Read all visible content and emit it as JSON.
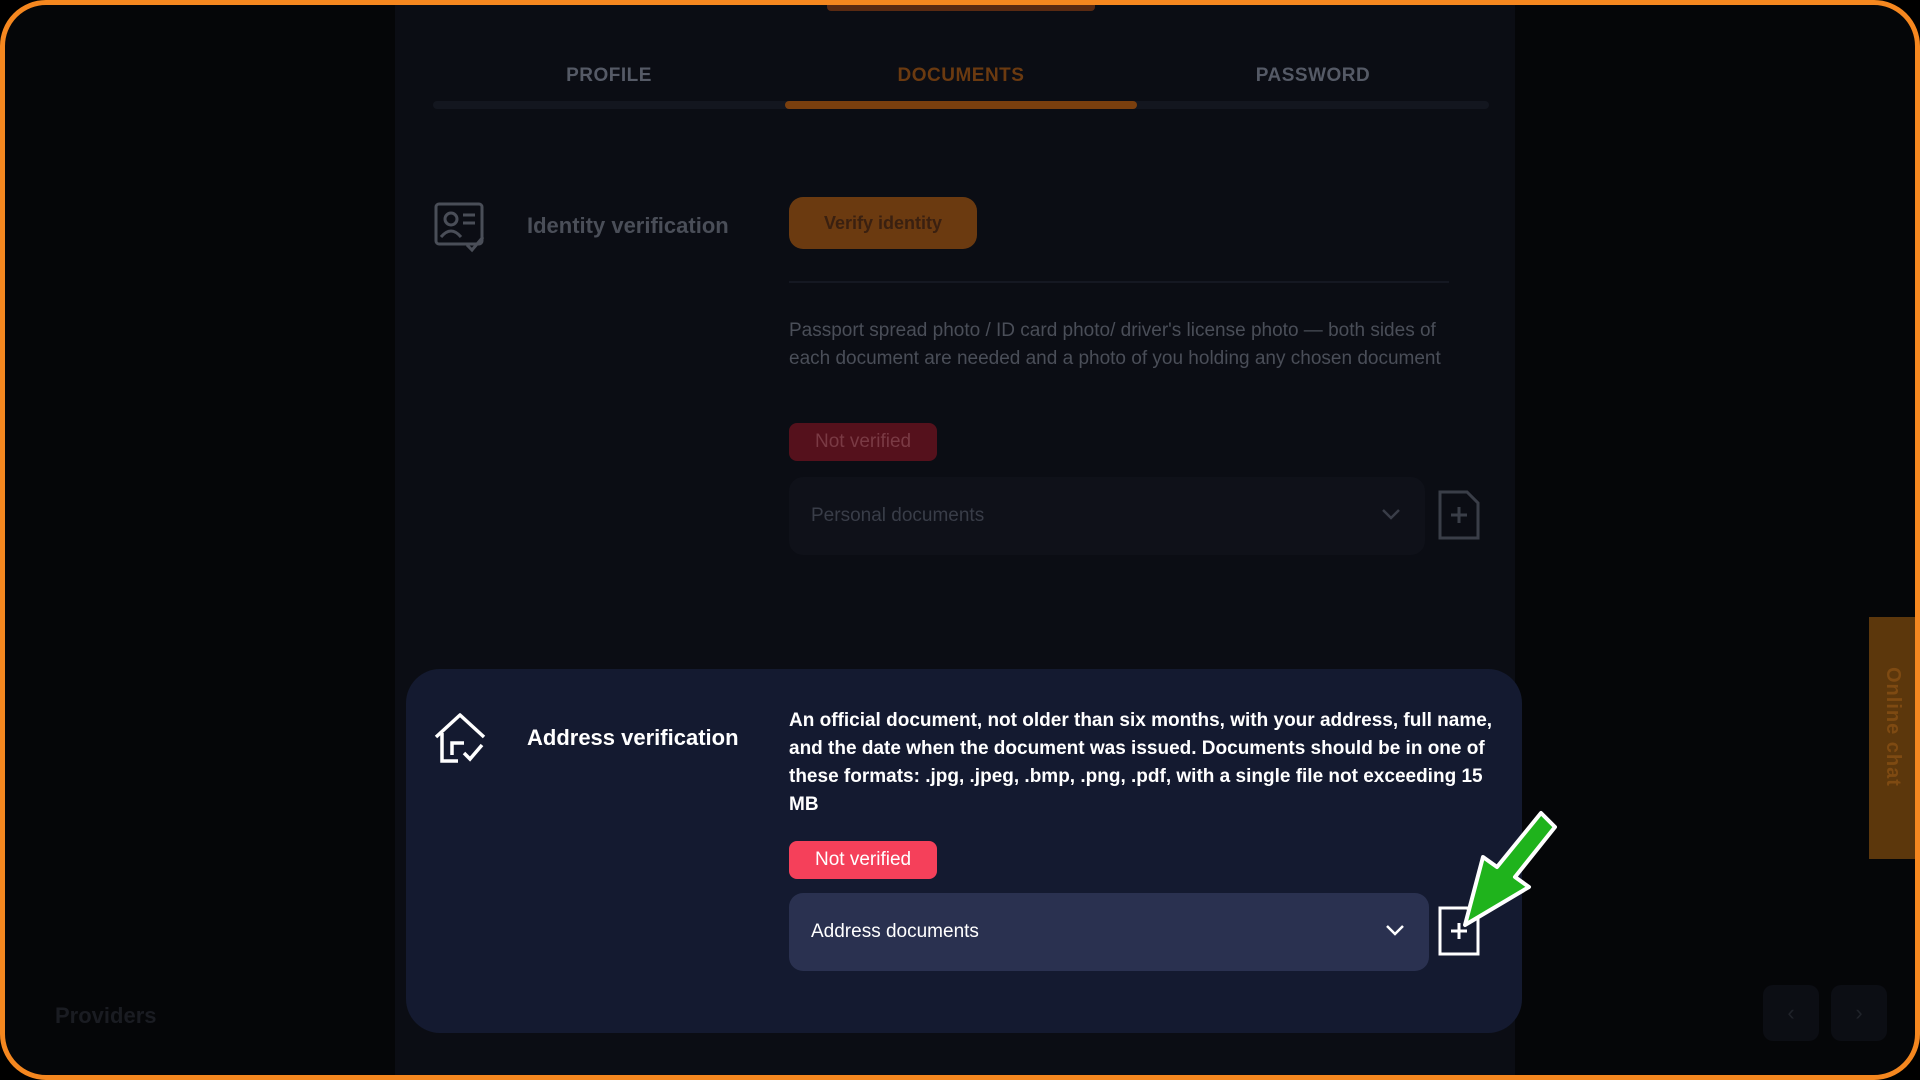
{
  "tabs": [
    {
      "label": "PROFILE",
      "active": false
    },
    {
      "label": "DOCUMENTS",
      "active": true
    },
    {
      "label": "PASSWORD",
      "active": false
    }
  ],
  "identity": {
    "title": "Identity verification",
    "verify_button": "Verify identity",
    "description": "Passport spread photo / ID card photo/ driver's license photo — both sides of each document are needed and a photo of you holding any chosen document",
    "status": "Not verified",
    "select_value": "Personal documents",
    "icon": "id-card-check-icon"
  },
  "address": {
    "title": "Address verification",
    "description": "An official document, not older than six months, with your address, full name, and the date when the document was issued. Documents should be in one of these formats: .jpg, .jpeg, .bmp, .png, .pdf, with a single file not exceeding 15 MB",
    "status": "Not verified",
    "select_value": "Address documents",
    "icon": "house-check-icon"
  },
  "footer": {
    "providers_label": "Providers",
    "prev": "‹",
    "next": "›"
  },
  "online_chat": "Online chat",
  "colors": {
    "accent": "#f5871f",
    "status_red": "#f5405a",
    "card_bg": "#141a30",
    "select_bg": "#2a3150",
    "annotation_arrow": "#1fb31c"
  }
}
